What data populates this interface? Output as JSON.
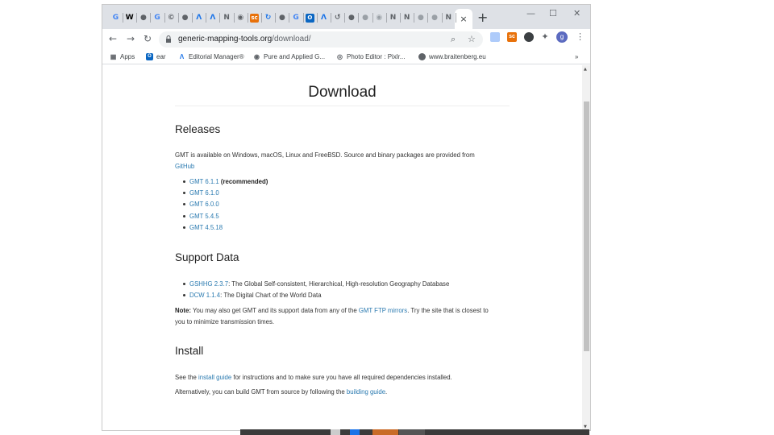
{
  "window": {
    "tab_favicons": [
      {
        "icon": "google-icon",
        "glyph": "G",
        "color": "#4285f4"
      },
      {
        "icon": "wikipedia-icon",
        "glyph": "W",
        "color": "#000000"
      },
      {
        "icon": "globe-icon",
        "glyph": "●",
        "color": "#5f6368"
      },
      {
        "icon": "google-icon",
        "glyph": "G",
        "color": "#4285f4"
      },
      {
        "icon": "copyright-icon",
        "glyph": "©",
        "color": "#5f6368"
      },
      {
        "icon": "globe-icon",
        "glyph": "●",
        "color": "#5f6368"
      },
      {
        "icon": "editorial-manager-icon",
        "glyph": "Λ",
        "color": "#1a73e8"
      },
      {
        "icon": "editorial-manager-icon",
        "glyph": "Λ",
        "color": "#1a73e8"
      },
      {
        "icon": "n-icon",
        "glyph": "N",
        "color": "#5f6368"
      },
      {
        "icon": "pure-icon",
        "glyph": "◉",
        "color": "#5f6368"
      },
      {
        "icon": "sc-icon",
        "glyph": "sc",
        "color": "#e8710a"
      },
      {
        "icon": "sync-icon",
        "glyph": "↻",
        "color": "#1a73e8"
      },
      {
        "icon": "globe-icon",
        "glyph": "●",
        "color": "#5f6368"
      },
      {
        "icon": "google-icon",
        "glyph": "G",
        "color": "#4285f4"
      },
      {
        "icon": "outlook-icon",
        "glyph": "O",
        "color": "#0a66c2"
      },
      {
        "icon": "editorial-manager-icon",
        "glyph": "Λ",
        "color": "#1a73e8"
      },
      {
        "icon": "history-icon",
        "glyph": "↺",
        "color": "#5f6368"
      },
      {
        "icon": "globe-icon",
        "glyph": "●",
        "color": "#5f6368"
      },
      {
        "icon": "cloud-icon",
        "glyph": "●",
        "color": "#9aa0a6"
      },
      {
        "icon": "eye-icon",
        "glyph": "◉",
        "color": "#9aa0a6"
      },
      {
        "icon": "n-icon",
        "glyph": "N",
        "color": "#5f6368"
      },
      {
        "icon": "n-icon",
        "glyph": "N",
        "color": "#5f6368"
      },
      {
        "icon": "cloud-icon",
        "glyph": "●",
        "color": "#9aa0a6"
      },
      {
        "icon": "cloud-icon",
        "glyph": "●",
        "color": "#9aa0a6"
      },
      {
        "icon": "n-icon",
        "glyph": "N",
        "color": "#5f6368"
      }
    ],
    "active_tab_close": "×",
    "new_tab": "+",
    "controls": {
      "minimize": "—",
      "maximize": "☐",
      "close": "✕"
    }
  },
  "toolbar": {
    "back": "←",
    "forward": "→",
    "reload": "↻",
    "url_domain": "generic-mapping-tools.org",
    "url_path": "/download/",
    "zoom_icon": "⌕",
    "star_icon": "☆",
    "profile_initial": "g",
    "menu": "⋮"
  },
  "bookmarks": [
    {
      "label": "Apps",
      "icon": "apps-grid-icon",
      "color": "#5f6368"
    },
    {
      "label": "ear",
      "icon": "outlook-icon",
      "color": "#0a66c2"
    },
    {
      "label": "Editorial Manager®",
      "icon": "editorial-manager-icon",
      "color": "#1a73e8"
    },
    {
      "label": "Pure and Applied G...",
      "icon": "pure-icon",
      "color": "#5f6368"
    },
    {
      "label": "Photo Editor : Pixlr...",
      "icon": "pixlr-icon",
      "color": "#5f6368"
    },
    {
      "label": "www.braitenberg.eu",
      "icon": "globe-icon",
      "color": "#5f6368"
    }
  ],
  "bookmarks_more": "»",
  "page": {
    "title": "Download",
    "releases": {
      "heading": "Releases",
      "intro": "GMT is available on Windows, macOS, Linux and FreeBSD. Source and binary packages are provided from",
      "intro_link": "GitHub",
      "items": [
        {
          "link": "GMT 6.1.1",
          "note": "(recommended)"
        },
        {
          "link": "GMT 6.1.0",
          "note": ""
        },
        {
          "link": "GMT 6.0.0",
          "note": ""
        },
        {
          "link": "GMT 5.4.5",
          "note": ""
        },
        {
          "link": "GMT 4.5.18",
          "note": ""
        }
      ]
    },
    "support": {
      "heading": "Support Data",
      "items": [
        {
          "link": "GSHHG 2.3.7",
          "text": ": The Global Self-consistent, Hierarchical, High-resolution Geography Database"
        },
        {
          "link": "DCW 1.1.4",
          "text": ": The Digital Chart of the World Data"
        }
      ],
      "note_label": "Note:",
      "note_text_1": " You may also get GMT and its support data from any of the ",
      "note_link": "GMT FTP mirrors",
      "note_text_2": ". Try the site that is closest to you to minimize transmission times."
    },
    "install": {
      "heading": "Install",
      "line1_pre": "See the ",
      "line1_link": "install guide",
      "line1_post": " for instructions and to make sure you have all required dependencies installed.",
      "line2_pre": "Alternatively, you can build GMT from source by following the ",
      "line2_link": "building guide",
      "line2_post": "."
    }
  },
  "scrollbar": {
    "up": "▲",
    "down": "▼"
  },
  "colors": {
    "link": "#2a7ab0",
    "tabstrip": "#dee1e6",
    "text": "#333333"
  }
}
